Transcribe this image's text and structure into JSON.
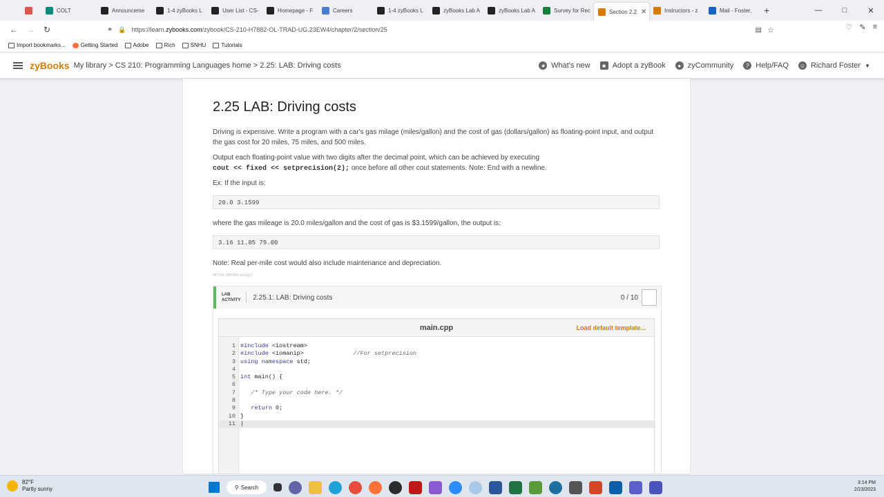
{
  "browser": {
    "tabs": [
      {
        "label": "",
        "color": "#e0554a"
      },
      {
        "label": "COLT",
        "color": "#0a8a7a"
      },
      {
        "label": "Announceme",
        "color": "#222222"
      },
      {
        "label": "1-4 zyBooks L",
        "color": "#222222"
      },
      {
        "label": "User List - CS-",
        "color": "#222222"
      },
      {
        "label": "Homepage - F",
        "color": "#222222"
      },
      {
        "label": "Careers",
        "color": "#4a7bd0"
      },
      {
        "label": "1-4 zyBooks L",
        "color": "#222222"
      },
      {
        "label": "zyBooks Lab A",
        "color": "#222222"
      },
      {
        "label": "zyBooks Lab A",
        "color": "#222222"
      },
      {
        "label": "Survey for Rec",
        "color": "#1a7f3a"
      },
      {
        "label": "Section 2.2",
        "color": "#d47b00",
        "active": true
      },
      {
        "label": "Instructors - z",
        "color": "#d47b00"
      },
      {
        "label": "Mail - Foster,",
        "color": "#1565c0"
      }
    ],
    "url_prefix": "https://learn.",
    "url_host": "zybooks.com",
    "url_path": "/zybook/CS-210-H7882-OL-TRAD-UG.23EW4/chapter/2/section/25",
    "bookmarks": [
      "Import bookmarks...",
      "Getting Started",
      "Adobe",
      "Rich",
      "SNHU",
      "Tutorials"
    ]
  },
  "header": {
    "logo": "zyBooks",
    "breadcrumb": "My library > CS 210: Programming Languages home > 2.25: LAB: Driving costs",
    "whats_new": "What's new",
    "adopt": "Adopt a zyBook",
    "community": "zyCommunity",
    "help": "Help/FAQ",
    "user": "Richard Foster"
  },
  "section": {
    "title": "2.25 LAB: Driving costs",
    "para1": "Driving is expensive. Write a program with a car's gas milage (miles/gallon) and the cost of gas (dollars/gallon) as floating-point input, and output the gas cost for 20 miles, 75 miles, and 500 miles.",
    "para2": "Output each floating-point value with two digits after the decimal point, which can be achieved by executing",
    "para2_code": "cout << fixed << setprecision(2);",
    "para2_rest": " once before all other cout statements. Note: End with a newline.",
    "ex_label": "Ex: If the input is:",
    "input_example": "20.0 3.1599",
    "where_text": "where the gas mileage is 20.0 miles/gallon and the cost of gas is $3.1599/gallon, the output is:",
    "output_example": "3.16 11.85 79.00",
    "note": "Note: Real per-mile cost would also include maintenance and depreciation.",
    "meta_id": "487258.2881864.qx3zqy7"
  },
  "lab": {
    "tag_line1": "LAB",
    "tag_line2": "ACTIVITY",
    "title": "2.25.1: LAB: Driving costs",
    "score": "0 / 10",
    "filename": "main.cpp",
    "load_template": "Load default template..."
  },
  "taskbar": {
    "temp": "82°F",
    "condition": "Partly sunny",
    "search": "Search",
    "time": "3:14 PM",
    "date": "2/23/2023"
  }
}
